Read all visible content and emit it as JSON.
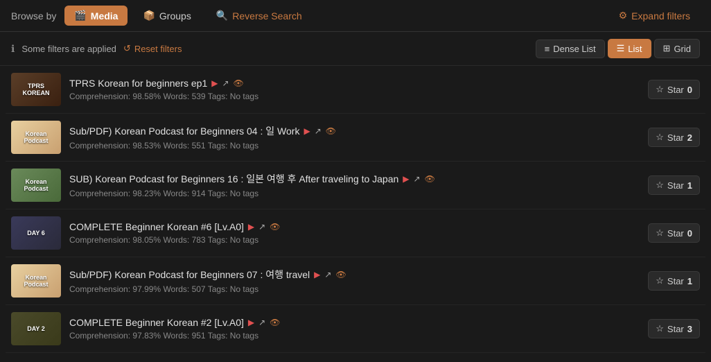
{
  "nav": {
    "browse_by": "Browse by",
    "tabs": [
      {
        "id": "media",
        "label": "Media",
        "icon": "🎬",
        "active": true
      },
      {
        "id": "groups",
        "label": "Groups",
        "icon": "📦",
        "active": false
      }
    ],
    "reverse_search_label": "Reverse Search",
    "expand_filters_label": "Expand filters"
  },
  "filter_bar": {
    "info_text": "Some filters are applied",
    "reset_label": "Reset filters",
    "views": [
      {
        "id": "dense",
        "label": "Dense List",
        "icon": "≡",
        "active": false
      },
      {
        "id": "list",
        "label": "List",
        "icon": "☰",
        "active": true
      },
      {
        "id": "grid",
        "label": "Grid",
        "icon": "⊞",
        "active": false
      }
    ]
  },
  "items": [
    {
      "id": 1,
      "thumb_class": "thumb-1",
      "thumb_label": "TPRS\nKOREAN",
      "title": "TPRS Korean for beginners ep1",
      "comprehension": "98.58%",
      "words": "539",
      "tags": "No tags",
      "stars": "0"
    },
    {
      "id": 2,
      "thumb_class": "thumb-2",
      "thumb_label": "Korean\nPodcast",
      "title": "Sub/PDF) Korean Podcast for Beginners 04 : 일 Work",
      "comprehension": "98.53%",
      "words": "551",
      "tags": "No tags",
      "stars": "2"
    },
    {
      "id": 3,
      "thumb_class": "thumb-3",
      "thumb_label": "Korean\nPodcast",
      "title": "SUB) Korean Podcast for Beginners 16 : 일본 여행 후 After traveling to Japan",
      "comprehension": "98.23%",
      "words": "914",
      "tags": "No tags",
      "stars": "1"
    },
    {
      "id": 4,
      "thumb_class": "thumb-4",
      "thumb_label": "DAY 6",
      "title": "COMPLETE Beginner Korean #6 [Lv.A0]",
      "comprehension": "98.05%",
      "words": "783",
      "tags": "No tags",
      "stars": "0"
    },
    {
      "id": 5,
      "thumb_class": "thumb-5",
      "thumb_label": "Korean\nPodcast",
      "title": "Sub/PDF) Korean Podcast for Beginners 07 : 여행 travel",
      "comprehension": "97.99%",
      "words": "507",
      "tags": "No tags",
      "stars": "1"
    },
    {
      "id": 6,
      "thumb_class": "thumb-6",
      "thumb_label": "DAY 2",
      "title": "COMPLETE Beginner Korean #2 [Lv.A0]",
      "comprehension": "97.83%",
      "words": "951",
      "tags": "No tags",
      "stars": "3"
    }
  ],
  "labels": {
    "comprehension_prefix": "Comprehension:",
    "words_prefix": "Words:",
    "tags_prefix": "Tags:",
    "star_label": "Star",
    "percent_suffix": "%"
  }
}
